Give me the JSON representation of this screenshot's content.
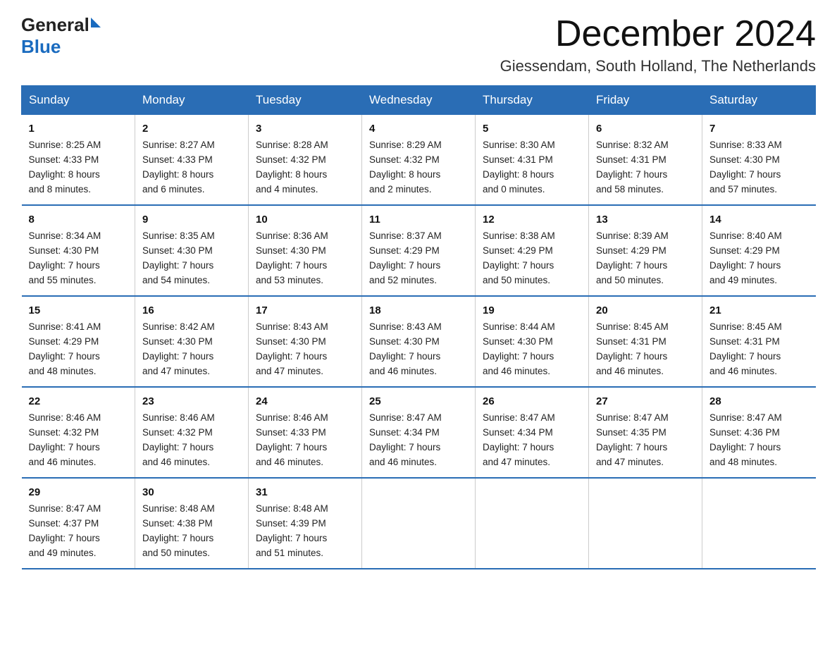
{
  "header": {
    "logo_general": "General",
    "logo_blue": "Blue",
    "title": "December 2024",
    "subtitle": "Giessendam, South Holland, The Netherlands"
  },
  "days_of_week": [
    "Sunday",
    "Monday",
    "Tuesday",
    "Wednesday",
    "Thursday",
    "Friday",
    "Saturday"
  ],
  "weeks": [
    [
      {
        "day": 1,
        "info": "Sunrise: 8:25 AM\nSunset: 4:33 PM\nDaylight: 8 hours\nand 8 minutes."
      },
      {
        "day": 2,
        "info": "Sunrise: 8:27 AM\nSunset: 4:33 PM\nDaylight: 8 hours\nand 6 minutes."
      },
      {
        "day": 3,
        "info": "Sunrise: 8:28 AM\nSunset: 4:32 PM\nDaylight: 8 hours\nand 4 minutes."
      },
      {
        "day": 4,
        "info": "Sunrise: 8:29 AM\nSunset: 4:32 PM\nDaylight: 8 hours\nand 2 minutes."
      },
      {
        "day": 5,
        "info": "Sunrise: 8:30 AM\nSunset: 4:31 PM\nDaylight: 8 hours\nand 0 minutes."
      },
      {
        "day": 6,
        "info": "Sunrise: 8:32 AM\nSunset: 4:31 PM\nDaylight: 7 hours\nand 58 minutes."
      },
      {
        "day": 7,
        "info": "Sunrise: 8:33 AM\nSunset: 4:30 PM\nDaylight: 7 hours\nand 57 minutes."
      }
    ],
    [
      {
        "day": 8,
        "info": "Sunrise: 8:34 AM\nSunset: 4:30 PM\nDaylight: 7 hours\nand 55 minutes."
      },
      {
        "day": 9,
        "info": "Sunrise: 8:35 AM\nSunset: 4:30 PM\nDaylight: 7 hours\nand 54 minutes."
      },
      {
        "day": 10,
        "info": "Sunrise: 8:36 AM\nSunset: 4:30 PM\nDaylight: 7 hours\nand 53 minutes."
      },
      {
        "day": 11,
        "info": "Sunrise: 8:37 AM\nSunset: 4:29 PM\nDaylight: 7 hours\nand 52 minutes."
      },
      {
        "day": 12,
        "info": "Sunrise: 8:38 AM\nSunset: 4:29 PM\nDaylight: 7 hours\nand 50 minutes."
      },
      {
        "day": 13,
        "info": "Sunrise: 8:39 AM\nSunset: 4:29 PM\nDaylight: 7 hours\nand 50 minutes."
      },
      {
        "day": 14,
        "info": "Sunrise: 8:40 AM\nSunset: 4:29 PM\nDaylight: 7 hours\nand 49 minutes."
      }
    ],
    [
      {
        "day": 15,
        "info": "Sunrise: 8:41 AM\nSunset: 4:29 PM\nDaylight: 7 hours\nand 48 minutes."
      },
      {
        "day": 16,
        "info": "Sunrise: 8:42 AM\nSunset: 4:30 PM\nDaylight: 7 hours\nand 47 minutes."
      },
      {
        "day": 17,
        "info": "Sunrise: 8:43 AM\nSunset: 4:30 PM\nDaylight: 7 hours\nand 47 minutes."
      },
      {
        "day": 18,
        "info": "Sunrise: 8:43 AM\nSunset: 4:30 PM\nDaylight: 7 hours\nand 46 minutes."
      },
      {
        "day": 19,
        "info": "Sunrise: 8:44 AM\nSunset: 4:30 PM\nDaylight: 7 hours\nand 46 minutes."
      },
      {
        "day": 20,
        "info": "Sunrise: 8:45 AM\nSunset: 4:31 PM\nDaylight: 7 hours\nand 46 minutes."
      },
      {
        "day": 21,
        "info": "Sunrise: 8:45 AM\nSunset: 4:31 PM\nDaylight: 7 hours\nand 46 minutes."
      }
    ],
    [
      {
        "day": 22,
        "info": "Sunrise: 8:46 AM\nSunset: 4:32 PM\nDaylight: 7 hours\nand 46 minutes."
      },
      {
        "day": 23,
        "info": "Sunrise: 8:46 AM\nSunset: 4:32 PM\nDaylight: 7 hours\nand 46 minutes."
      },
      {
        "day": 24,
        "info": "Sunrise: 8:46 AM\nSunset: 4:33 PM\nDaylight: 7 hours\nand 46 minutes."
      },
      {
        "day": 25,
        "info": "Sunrise: 8:47 AM\nSunset: 4:34 PM\nDaylight: 7 hours\nand 46 minutes."
      },
      {
        "day": 26,
        "info": "Sunrise: 8:47 AM\nSunset: 4:34 PM\nDaylight: 7 hours\nand 47 minutes."
      },
      {
        "day": 27,
        "info": "Sunrise: 8:47 AM\nSunset: 4:35 PM\nDaylight: 7 hours\nand 47 minutes."
      },
      {
        "day": 28,
        "info": "Sunrise: 8:47 AM\nSunset: 4:36 PM\nDaylight: 7 hours\nand 48 minutes."
      }
    ],
    [
      {
        "day": 29,
        "info": "Sunrise: 8:47 AM\nSunset: 4:37 PM\nDaylight: 7 hours\nand 49 minutes."
      },
      {
        "day": 30,
        "info": "Sunrise: 8:48 AM\nSunset: 4:38 PM\nDaylight: 7 hours\nand 50 minutes."
      },
      {
        "day": 31,
        "info": "Sunrise: 8:48 AM\nSunset: 4:39 PM\nDaylight: 7 hours\nand 51 minutes."
      },
      null,
      null,
      null,
      null
    ]
  ]
}
